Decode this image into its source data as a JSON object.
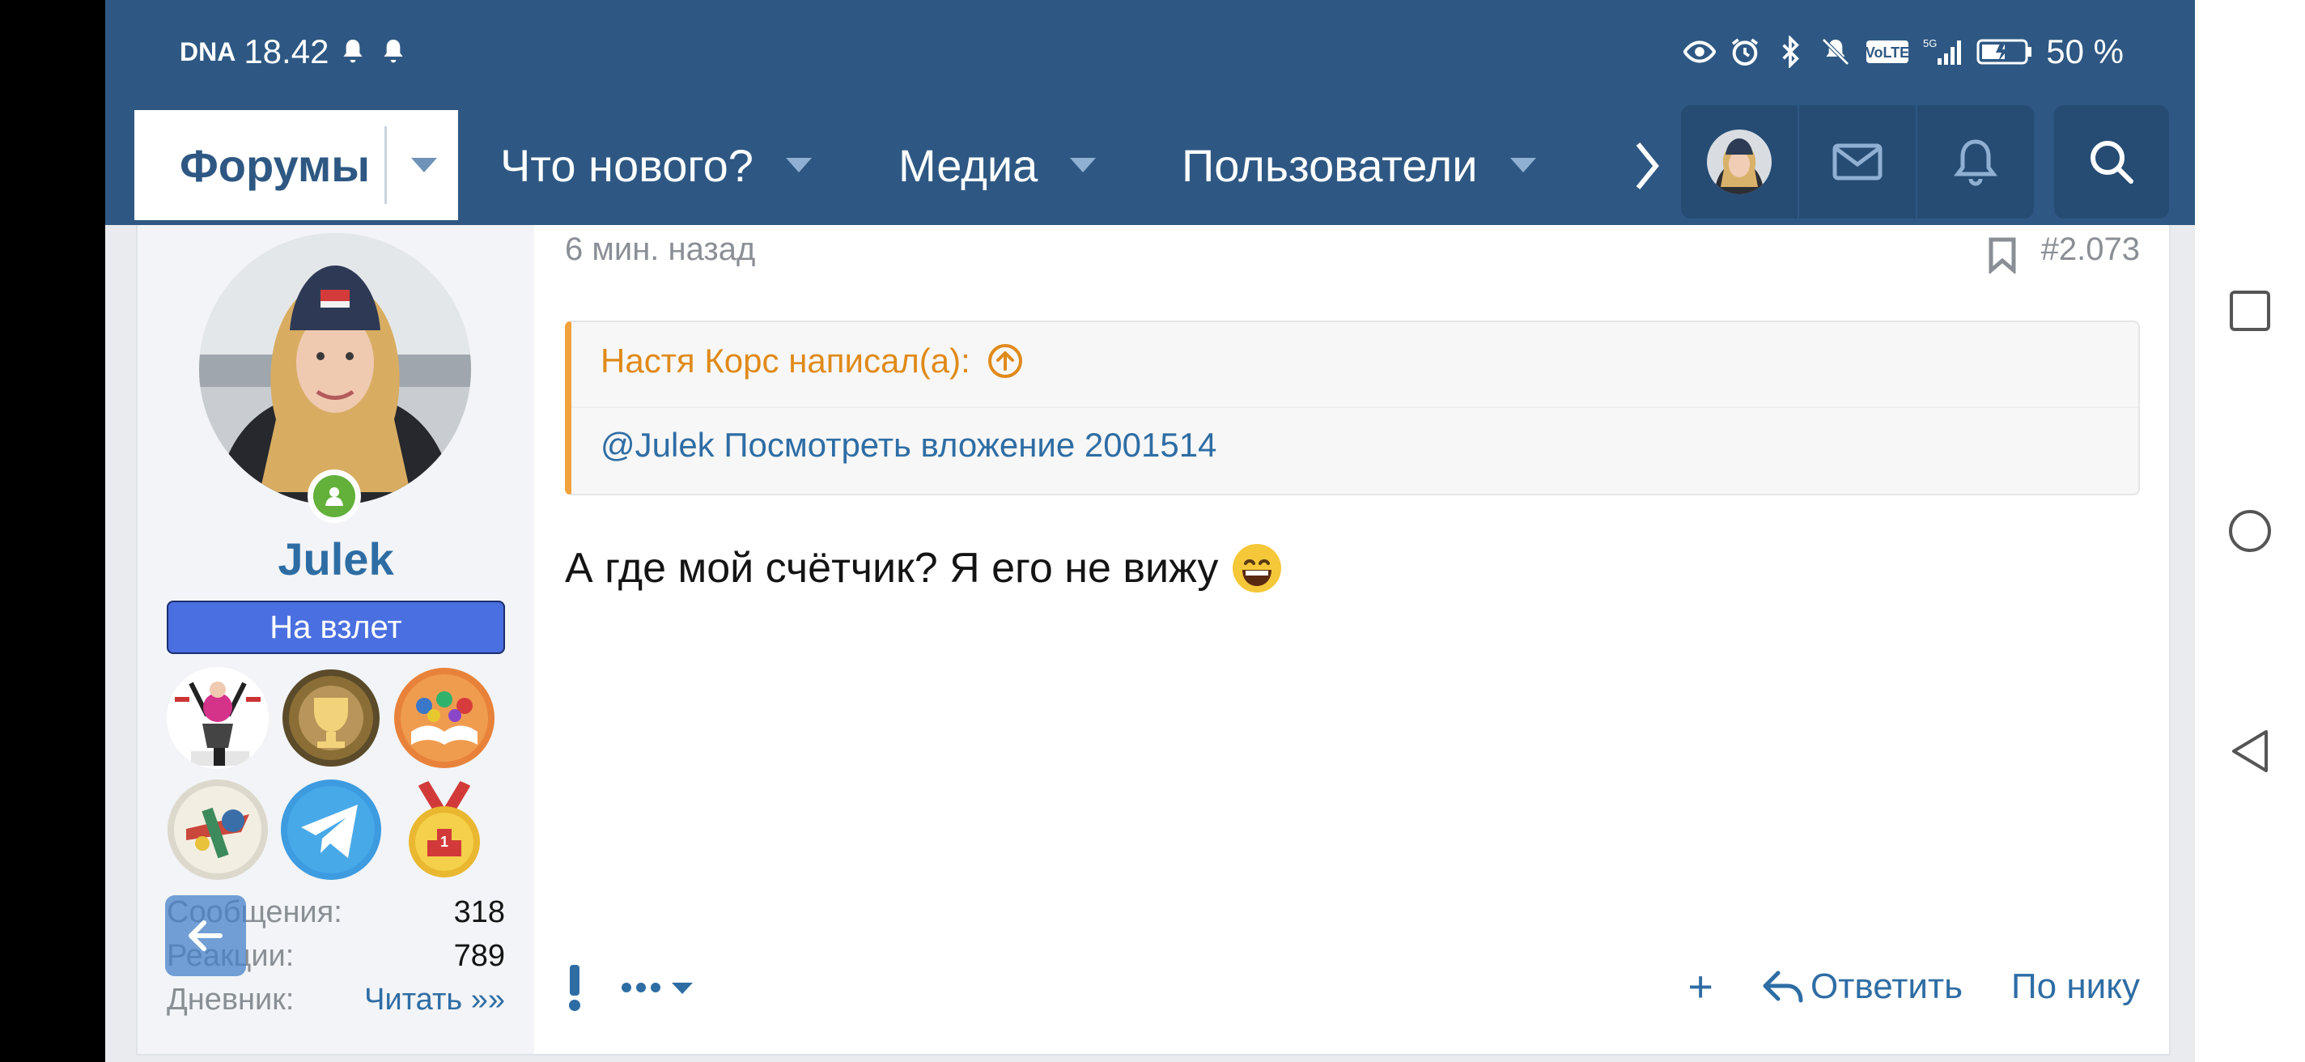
{
  "status_bar": {
    "carrier": "DNA",
    "time": "18.42",
    "battery": "50 %"
  },
  "nav": {
    "tabs": [
      {
        "label": "Форумы",
        "active": true
      },
      {
        "label": "Что нового?"
      },
      {
        "label": "Медиа"
      },
      {
        "label": "Пользователи"
      }
    ],
    "icons": [
      "avatar-icon",
      "mail-icon",
      "bell-icon",
      "search-icon"
    ]
  },
  "author": {
    "username": "Julek",
    "user_title": "На взлет",
    "stats": [
      {
        "label": "Сообщения:",
        "value": "318"
      },
      {
        "label": "Реакции:",
        "value": "789"
      },
      {
        "label": "Дневник:",
        "value": "Читать »»"
      }
    ]
  },
  "post": {
    "time_ago": "6 мин. назад",
    "post_number": "#2.073",
    "quote": {
      "header": "Настя Корс написал(а):",
      "body": "@Julek Посмотреть вложение 2001514"
    },
    "message": "А где мой счётчик? Я его не вижу",
    "actions": {
      "plus": "+",
      "reply": "Ответить",
      "by_nick": "По нику"
    }
  },
  "colors": {
    "header": "#2e5883",
    "link": "#2e6da4",
    "quote_accent": "#f1a23c",
    "user_banner": "#4a6fe0"
  }
}
